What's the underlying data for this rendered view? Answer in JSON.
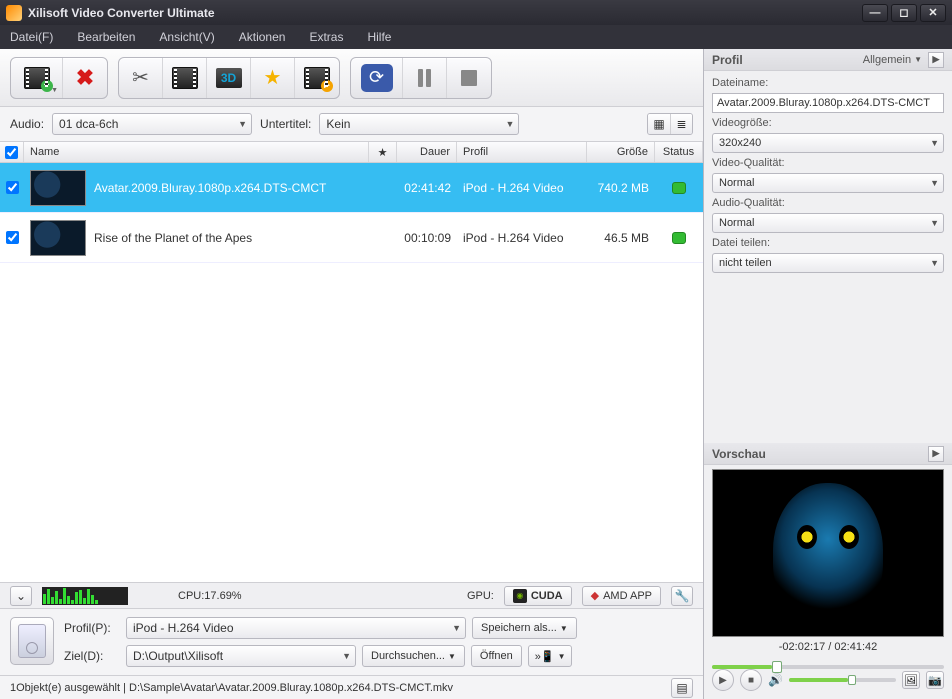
{
  "title": "Xilisoft Video Converter Ultimate",
  "menu": [
    "Datei(F)",
    "Bearbeiten",
    "Ansicht(V)",
    "Aktionen",
    "Extras",
    "Hilfe"
  ],
  "audioLabel": "Audio:",
  "audioValue": "01 dca-6ch",
  "subtitleLabel": "Untertitel:",
  "subtitleValue": "Kein",
  "columns": {
    "name": "Name",
    "dur": "Dauer",
    "profile": "Profil",
    "size": "Größe",
    "status": "Status"
  },
  "rows": [
    {
      "checked": true,
      "name": "Avatar.2009.Bluray.1080p.x264.DTS-CMCT",
      "dur": "02:41:42",
      "profile": "iPod - H.264 Video",
      "size": "740.2 MB",
      "selected": true
    },
    {
      "checked": true,
      "name": "Rise of the Planet of the Apes",
      "dur": "00:10:09",
      "profile": "iPod - H.264 Video",
      "size": "46.5 MB",
      "selected": false
    }
  ],
  "cpu": {
    "label": "CPU:17.69%",
    "gpuLabel": "GPU:",
    "cuda": "CUDA",
    "amd": "AMD APP"
  },
  "profdest": {
    "profileLabel": "Profil(P):",
    "profileValue": "iPod - H.264 Video",
    "saveAs": "Speichern als...",
    "destLabel": "Ziel(D):",
    "destValue": "D:\\Output\\Xilisoft",
    "browse": "Durchsuchen...",
    "open": "Öffnen"
  },
  "statusbar": "1Objekt(e) ausgewählt | D:\\Sample\\Avatar\\Avatar.2009.Bluray.1080p.x264.DTS-CMCT.mkv",
  "right": {
    "profileHeader": "Profil",
    "profileTab": "Allgemein",
    "filenameLabel": "Dateiname:",
    "filenameValue": "Avatar.2009.Bluray.1080p.x264.DTS-CMCT",
    "videoSizeLabel": "Videogröße:",
    "videoSizeValue": "320x240",
    "videoQualityLabel": "Video-Qualität:",
    "videoQualityValue": "Normal",
    "audioQualityLabel": "Audio-Qualität:",
    "audioQualityValue": "Normal",
    "splitLabel": "Datei teilen:",
    "splitValue": "nicht teilen",
    "previewHeader": "Vorschau",
    "time": "-02:02:17 / 02:41:42"
  }
}
